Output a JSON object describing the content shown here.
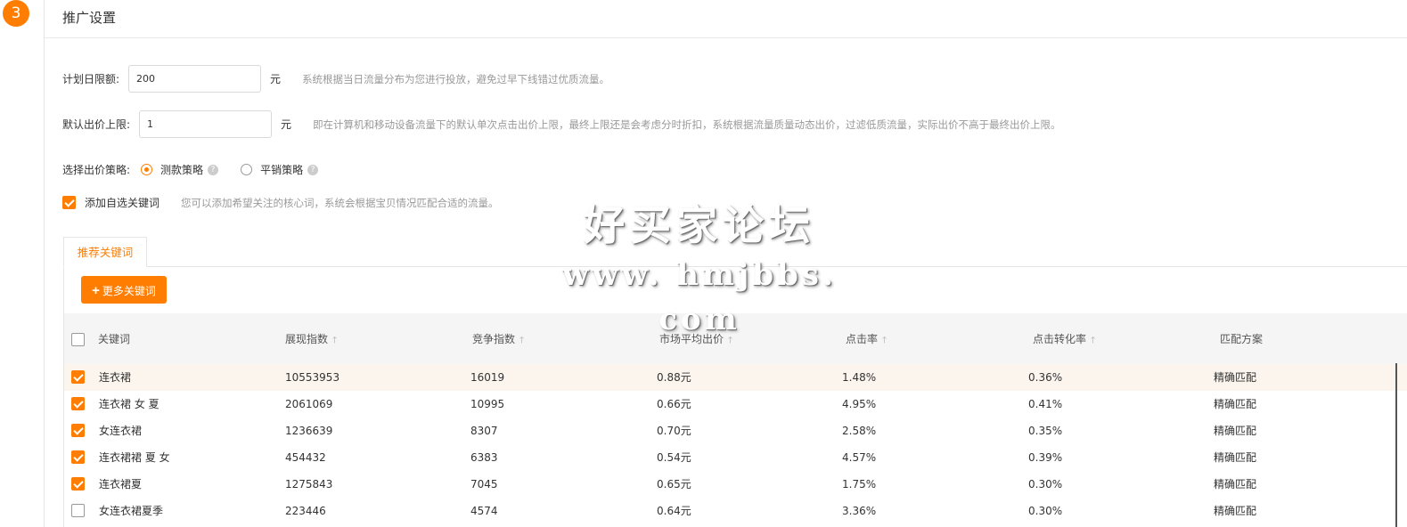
{
  "step": {
    "number": "3"
  },
  "section": {
    "title": "推广设置"
  },
  "budget": {
    "label": "计划日限额:",
    "value": "200",
    "unit": "元",
    "hint": "系统根据当日流量分布为您进行投放，避免过早下线错过优质流量。"
  },
  "max_bid": {
    "label": "默认出价上限:",
    "value": "1",
    "unit": "元",
    "hint": "即在计算机和移动设备流量下的默认单次点击出价上限，最终上限还是会考虑分时折扣，系统根据流量质量动态出价，过滤低质流量，实际出价不高于最终出价上限。"
  },
  "strategy": {
    "label": "选择出价策略:",
    "options": [
      {
        "label": "测款策略",
        "selected": true
      },
      {
        "label": "平销策略",
        "selected": false
      }
    ]
  },
  "custom_keywords": {
    "label": "添加自选关键词",
    "checked": true,
    "hint": "您可以添加希望关注的核心词，系统会根据宝贝情况匹配合适的流量。"
  },
  "tabs": [
    {
      "label": "推荐关键词",
      "active": true
    }
  ],
  "more_button": {
    "label": "更多关键词"
  },
  "table": {
    "headers": [
      "关键词",
      "展现指数",
      "竞争指数",
      "市场平均出价",
      "点击率",
      "点击转化率",
      "匹配方案"
    ],
    "rows": [
      {
        "checked": true,
        "keyword": "连衣裙",
        "impressions": "10553953",
        "competition": "16019",
        "avg_bid": "0.88元",
        "ctr": "1.48%",
        "cvr": "0.36%",
        "match": "精确匹配"
      },
      {
        "checked": true,
        "keyword": "连衣裙 女 夏",
        "impressions": "2061069",
        "competition": "10995",
        "avg_bid": "0.66元",
        "ctr": "4.95%",
        "cvr": "0.41%",
        "match": "精确匹配"
      },
      {
        "checked": true,
        "keyword": "女连衣裙",
        "impressions": "1236639",
        "competition": "8307",
        "avg_bid": "0.70元",
        "ctr": "2.58%",
        "cvr": "0.35%",
        "match": "精确匹配"
      },
      {
        "checked": true,
        "keyword": "连衣裙裙 夏 女",
        "impressions": "454432",
        "competition": "6383",
        "avg_bid": "0.54元",
        "ctr": "4.57%",
        "cvr": "0.39%",
        "match": "精确匹配"
      },
      {
        "checked": true,
        "keyword": "连衣裙夏",
        "impressions": "1275843",
        "competition": "7045",
        "avg_bid": "0.65元",
        "ctr": "1.75%",
        "cvr": "0.30%",
        "match": "精确匹配"
      },
      {
        "checked": false,
        "keyword": "女连衣裙夏季",
        "impressions": "223446",
        "competition": "4574",
        "avg_bid": "0.64元",
        "ctr": "3.36%",
        "cvr": "0.30%",
        "match": "精确匹配"
      }
    ]
  },
  "watermark": {
    "line1": "好买家论坛",
    "line2": "www. hmjbbs. com"
  },
  "colors": {
    "accent": "#ff7d00",
    "hint": "#999999",
    "header_bg": "#f5f5f5",
    "highlight_row": "#fbf5ee"
  },
  "icons": {
    "help": "question-circle-icon",
    "plus": "plus-icon"
  }
}
